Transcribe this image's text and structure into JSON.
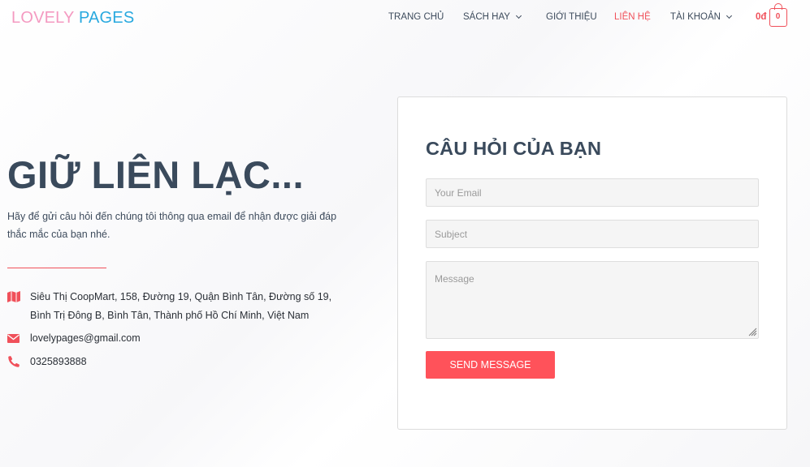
{
  "header": {
    "logo_part1": "LOVELY",
    "logo_part2": "PAGES",
    "nav": [
      {
        "label": "TRANG CHỦ",
        "has_dropdown": false,
        "active": false
      },
      {
        "label": "SÁCH HAY",
        "has_dropdown": true,
        "active": false
      },
      {
        "label": "GIỚI THIỆU",
        "has_dropdown": false,
        "active": false
      },
      {
        "label": "LIÊN HỆ",
        "has_dropdown": false,
        "active": true
      },
      {
        "label": "TÀI KHOẢN",
        "has_dropdown": true,
        "active": false
      }
    ],
    "cart_price": "0đ",
    "cart_count": "0"
  },
  "contact": {
    "title": "GIỮ LIÊN LẠC...",
    "description": "Hãy để gửi câu hỏi đến chúng tôi thông qua email để nhận được giải đáp thắc mắc của bạn nhé.",
    "address_line1": "Siêu Thị CoopMart, 158, Đường 19, Quận Bình Tân, Đường số 19,",
    "address_line2": "Bình Trị Đông B, Bình Tân, Thành phố Hồ Chí Minh, Việt Nam",
    "email": "lovelypages@gmail.com",
    "phone": "0325893888"
  },
  "form": {
    "title": "CÂU HỎI CỦA BẠN",
    "email_placeholder": "Your Email",
    "subject_placeholder": "Subject",
    "message_placeholder": "Message",
    "submit_label": "SEND MESSAGE"
  },
  "colors": {
    "accent": "#f0505a",
    "button": "#ff525a",
    "logo_pink": "#f49ac1",
    "logo_blue": "#29a9df",
    "heading": "#3a4a5c"
  },
  "icons": {
    "address": "map-icon",
    "email": "envelope-icon",
    "phone": "phone-icon",
    "cart": "shopping-bag-icon"
  }
}
